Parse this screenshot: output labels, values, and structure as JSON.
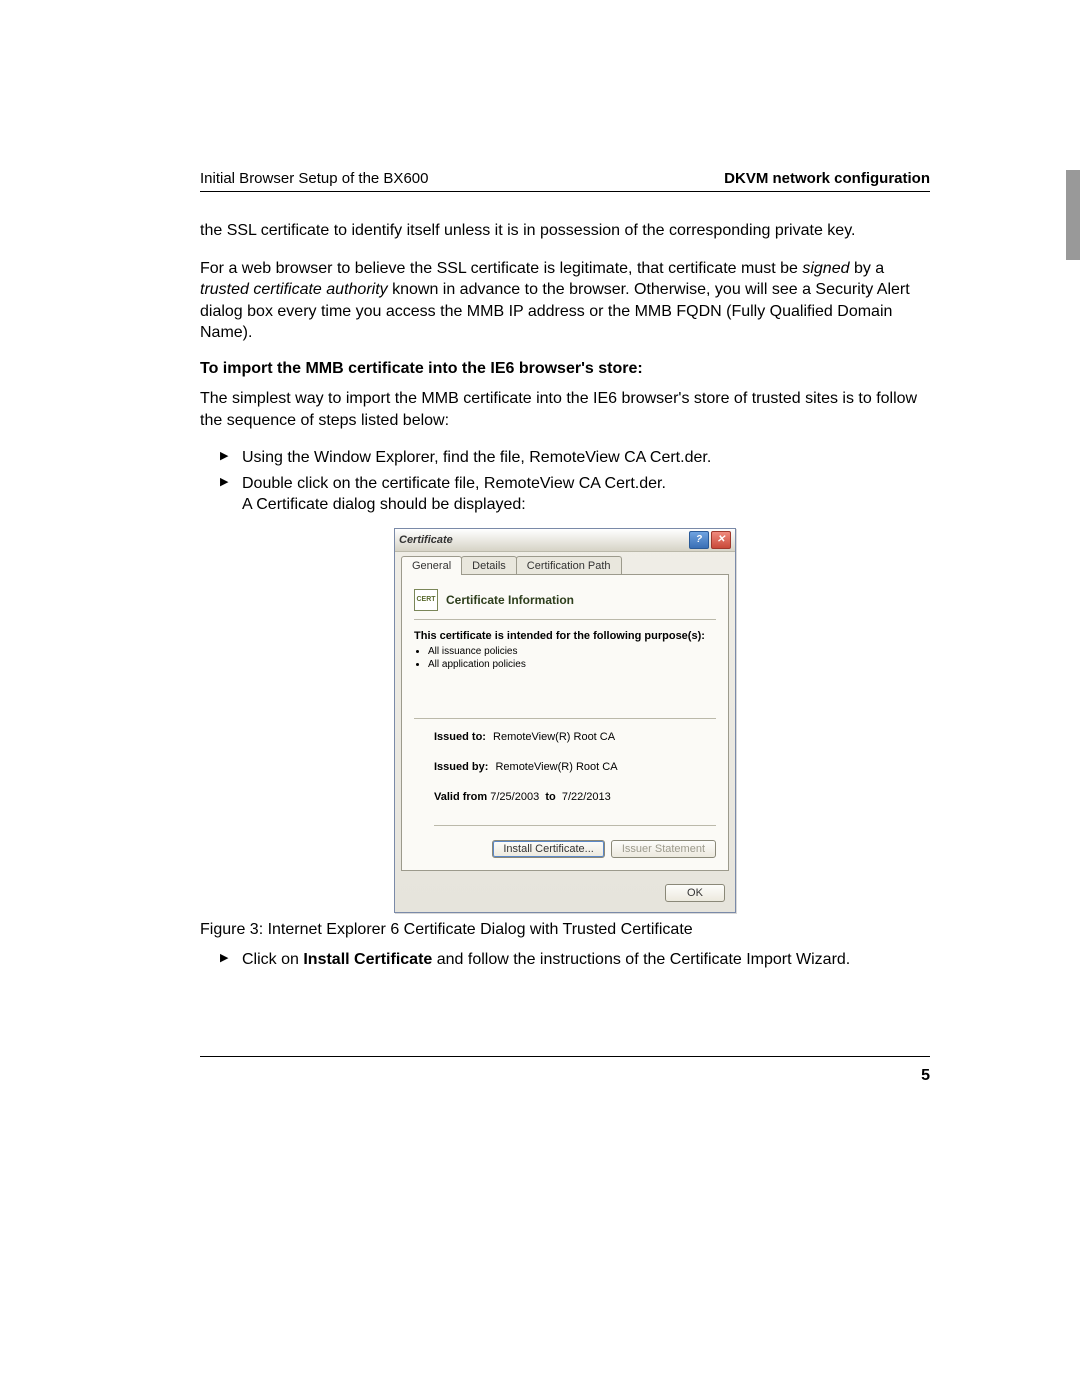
{
  "header": {
    "left": "Initial Browser Setup of the BX600",
    "right": "DKVM network configuration"
  },
  "para1_a": "the SSL certificate to identify itself unless it is in possession of the corresponding private key.",
  "para1_b_prefix": "For a web browser to believe the SSL certificate is legitimate, that certificate must be ",
  "para1_b_signed": "signed",
  "para1_b_by": " by a ",
  "para1_b_tca": "trusted certificate authority",
  "para1_b_suffix": " known in advance to the browser. Otherwise, you will see a Security Alert dialog box every time you access the MMB IP address or the MMB FQDN (Fully Qualified Domain Name).",
  "section_title": "To import the MMB certificate into the IE6 browser's store:",
  "para2": "The simplest way to import the MMB certificate into the IE6 browser's store of trusted sites is to follow the sequence of steps listed below:",
  "bullets_a": {
    "0": "Using the Window Explorer, find the file, RemoteView CA Cert.der.",
    "1": "Double click on the certificate file, RemoteView CA Cert.der.",
    "1_sub": "A Certificate dialog should be displayed:"
  },
  "dialog": {
    "title": "Certificate",
    "tabs": {
      "general": "General",
      "details": "Details",
      "path": "Certification Path"
    },
    "info_title": "Certificate Information",
    "intended": "This certificate is intended for the following purpose(s):",
    "purposes": {
      "0": "All issuance policies",
      "1": "All application policies"
    },
    "issued_to_label": "Issued to:",
    "issued_to_value": "RemoteView(R) Root CA",
    "issued_by_label": "Issued by:",
    "issued_by_value": "RemoteView(R) Root CA",
    "valid_from_label": "Valid from",
    "valid_from_value": "7/25/2003",
    "valid_to_label": "to",
    "valid_to_value": "7/22/2013",
    "install_btn": "Install Certificate...",
    "issuer_btn": "Issuer Statement",
    "ok_btn": "OK",
    "help_btn": "?",
    "close_btn": "✕"
  },
  "fig_caption": "Figure 3: Internet Explorer 6 Certificate Dialog with Trusted Certificate",
  "bullets_b_prefix": "Click on ",
  "bullets_b_bold": "Install Certificate",
  "bullets_b_suffix": " and follow the instructions of the Certificate Import Wizard.",
  "page_number": "5"
}
